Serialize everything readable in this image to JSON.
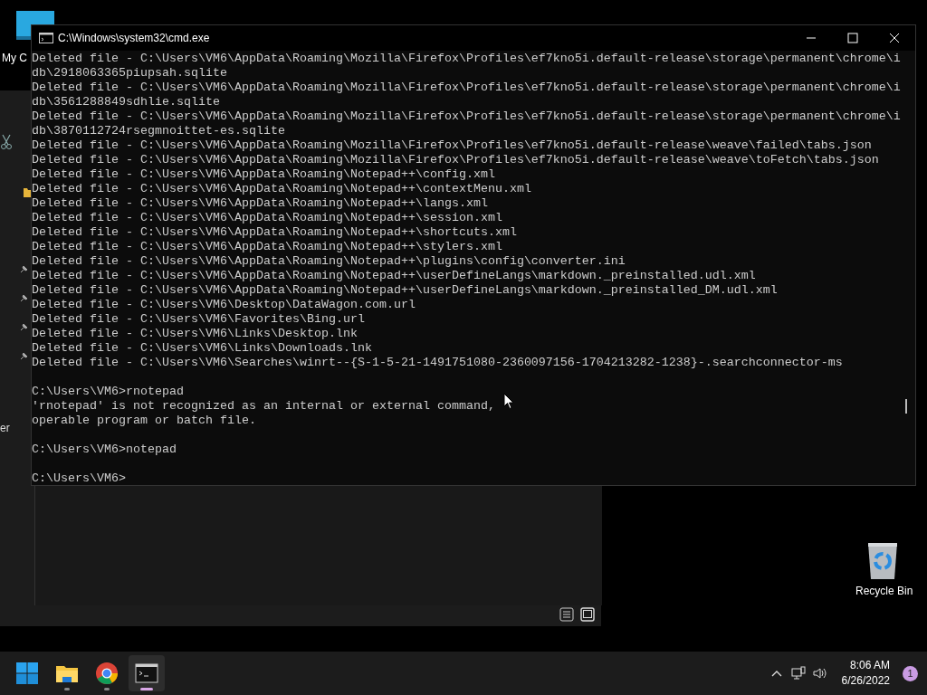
{
  "desktop": {
    "computer_label": "My C",
    "recycle_bin_label": "Recycle Bin"
  },
  "background_window": {
    "side_text": "er"
  },
  "console": {
    "title": "C:\\Windows\\system32\\cmd.exe",
    "blocks": [
      [
        "Deleted file - C:\\Users\\VM6\\AppData\\Roaming\\Mozilla\\Firefox\\Profiles\\ef7kno5i.default-release\\storage\\permanent\\chrome\\i",
        "db\\2918063365piupsah.sqlite",
        "Deleted file - C:\\Users\\VM6\\AppData\\Roaming\\Mozilla\\Firefox\\Profiles\\ef7kno5i.default-release\\storage\\permanent\\chrome\\i",
        "db\\3561288849sdhlie.sqlite",
        "Deleted file - C:\\Users\\VM6\\AppData\\Roaming\\Mozilla\\Firefox\\Profiles\\ef7kno5i.default-release\\storage\\permanent\\chrome\\i",
        "db\\3870112724rsegmnoittet-es.sqlite",
        "Deleted file - C:\\Users\\VM6\\AppData\\Roaming\\Mozilla\\Firefox\\Profiles\\ef7kno5i.default-release\\weave\\failed\\tabs.json",
        "Deleted file - C:\\Users\\VM6\\AppData\\Roaming\\Mozilla\\Firefox\\Profiles\\ef7kno5i.default-release\\weave\\toFetch\\tabs.json",
        "Deleted file - C:\\Users\\VM6\\AppData\\Roaming\\Notepad++\\config.xml",
        "Deleted file - C:\\Users\\VM6\\AppData\\Roaming\\Notepad++\\contextMenu.xml",
        "Deleted file - C:\\Users\\VM6\\AppData\\Roaming\\Notepad++\\langs.xml",
        "Deleted file - C:\\Users\\VM6\\AppData\\Roaming\\Notepad++\\session.xml",
        "Deleted file - C:\\Users\\VM6\\AppData\\Roaming\\Notepad++\\shortcuts.xml",
        "Deleted file - C:\\Users\\VM6\\AppData\\Roaming\\Notepad++\\stylers.xml",
        "Deleted file - C:\\Users\\VM6\\AppData\\Roaming\\Notepad++\\plugins\\config\\converter.ini",
        "Deleted file - C:\\Users\\VM6\\AppData\\Roaming\\Notepad++\\userDefineLangs\\markdown._preinstalled.udl.xml",
        "Deleted file - C:\\Users\\VM6\\AppData\\Roaming\\Notepad++\\userDefineLangs\\markdown._preinstalled_DM.udl.xml",
        "Deleted file - C:\\Users\\VM6\\Desktop\\DataWagon.com.url",
        "Deleted file - C:\\Users\\VM6\\Favorites\\Bing.url",
        "Deleted file - C:\\Users\\VM6\\Links\\Desktop.lnk",
        "Deleted file - C:\\Users\\VM6\\Links\\Downloads.lnk",
        "Deleted file - C:\\Users\\VM6\\Searches\\winrt--{S-1-5-21-1491751080-2360097156-1704213282-1238}-.searchconnector-ms"
      ],
      [
        "C:\\Users\\VM6>rnotepad",
        "'rnotepad' is not recognized as an internal or external command,",
        "operable program or batch file."
      ],
      [
        "C:\\Users\\VM6>notepad"
      ],
      [
        "C:\\Users\\VM6>"
      ]
    ]
  },
  "taskbar": {
    "apps": [
      {
        "kind": "start",
        "running": false,
        "selected": false
      },
      {
        "kind": "files",
        "running": true,
        "selected": false
      },
      {
        "kind": "browser",
        "running": true,
        "selected": false
      },
      {
        "kind": "terminal",
        "running": true,
        "selected": true
      }
    ],
    "clock": {
      "time": "8:06 AM",
      "date": "6/26/2022"
    },
    "notification_count": "1"
  }
}
